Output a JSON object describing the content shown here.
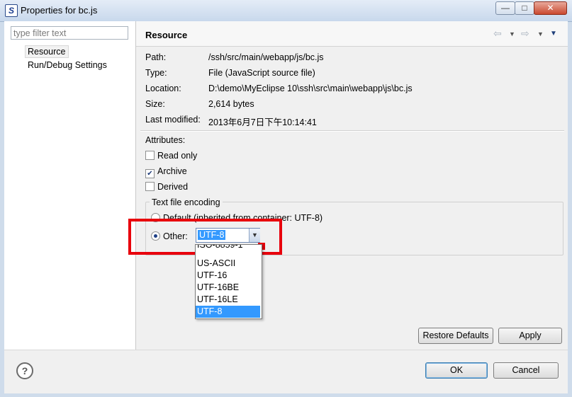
{
  "window": {
    "title": "Properties for bc.js",
    "app_icon_letter": "S",
    "min": "—",
    "max": "□",
    "close": "✕"
  },
  "filter": {
    "placeholder": "type filter text"
  },
  "tree": {
    "items": [
      "Resource",
      "Run/Debug Settings"
    ]
  },
  "page": {
    "title": "Resource"
  },
  "nav": {
    "back": "⇦",
    "forward": "⇨",
    "menu_arrow": "▼",
    "view_menu": "▼"
  },
  "info": [
    {
      "label": "Path:",
      "value": "/ssh/src/main/webapp/js/bc.js"
    },
    {
      "label": "Type:",
      "value": "File  (JavaScript source file)"
    },
    {
      "label": "Location:",
      "value": "D:\\demo\\MyEclipse 10\\ssh\\src\\main\\webapp\\js\\bc.js"
    },
    {
      "label": "Size:",
      "value": "2,614  bytes"
    },
    {
      "label": "Last modified:",
      "value": "2013年6月7日下午10:14:41"
    }
  ],
  "attributes": {
    "label": "Attributes:",
    "checkboxes": [
      {
        "label": "Read only",
        "checked": false
      },
      {
        "label": "Archive",
        "checked": true
      },
      {
        "label": "Derived",
        "checked": false
      }
    ]
  },
  "encoding": {
    "group_label": "Text file encoding",
    "default_label": "Default (inherited from container: UTF-8)",
    "other_label": "Other:",
    "selected": "UTF-8",
    "options": [
      "ISO-8859-1",
      "US-ASCII",
      "UTF-16",
      "UTF-16BE",
      "UTF-16LE",
      "UTF-8"
    ]
  },
  "buttons": {
    "restore": "Restore Defaults",
    "apply": "Apply",
    "ok": "OK",
    "cancel": "Cancel",
    "help": "?"
  },
  "colors": {
    "highlight_box": "#e8000c",
    "selection": "#3399ff"
  }
}
